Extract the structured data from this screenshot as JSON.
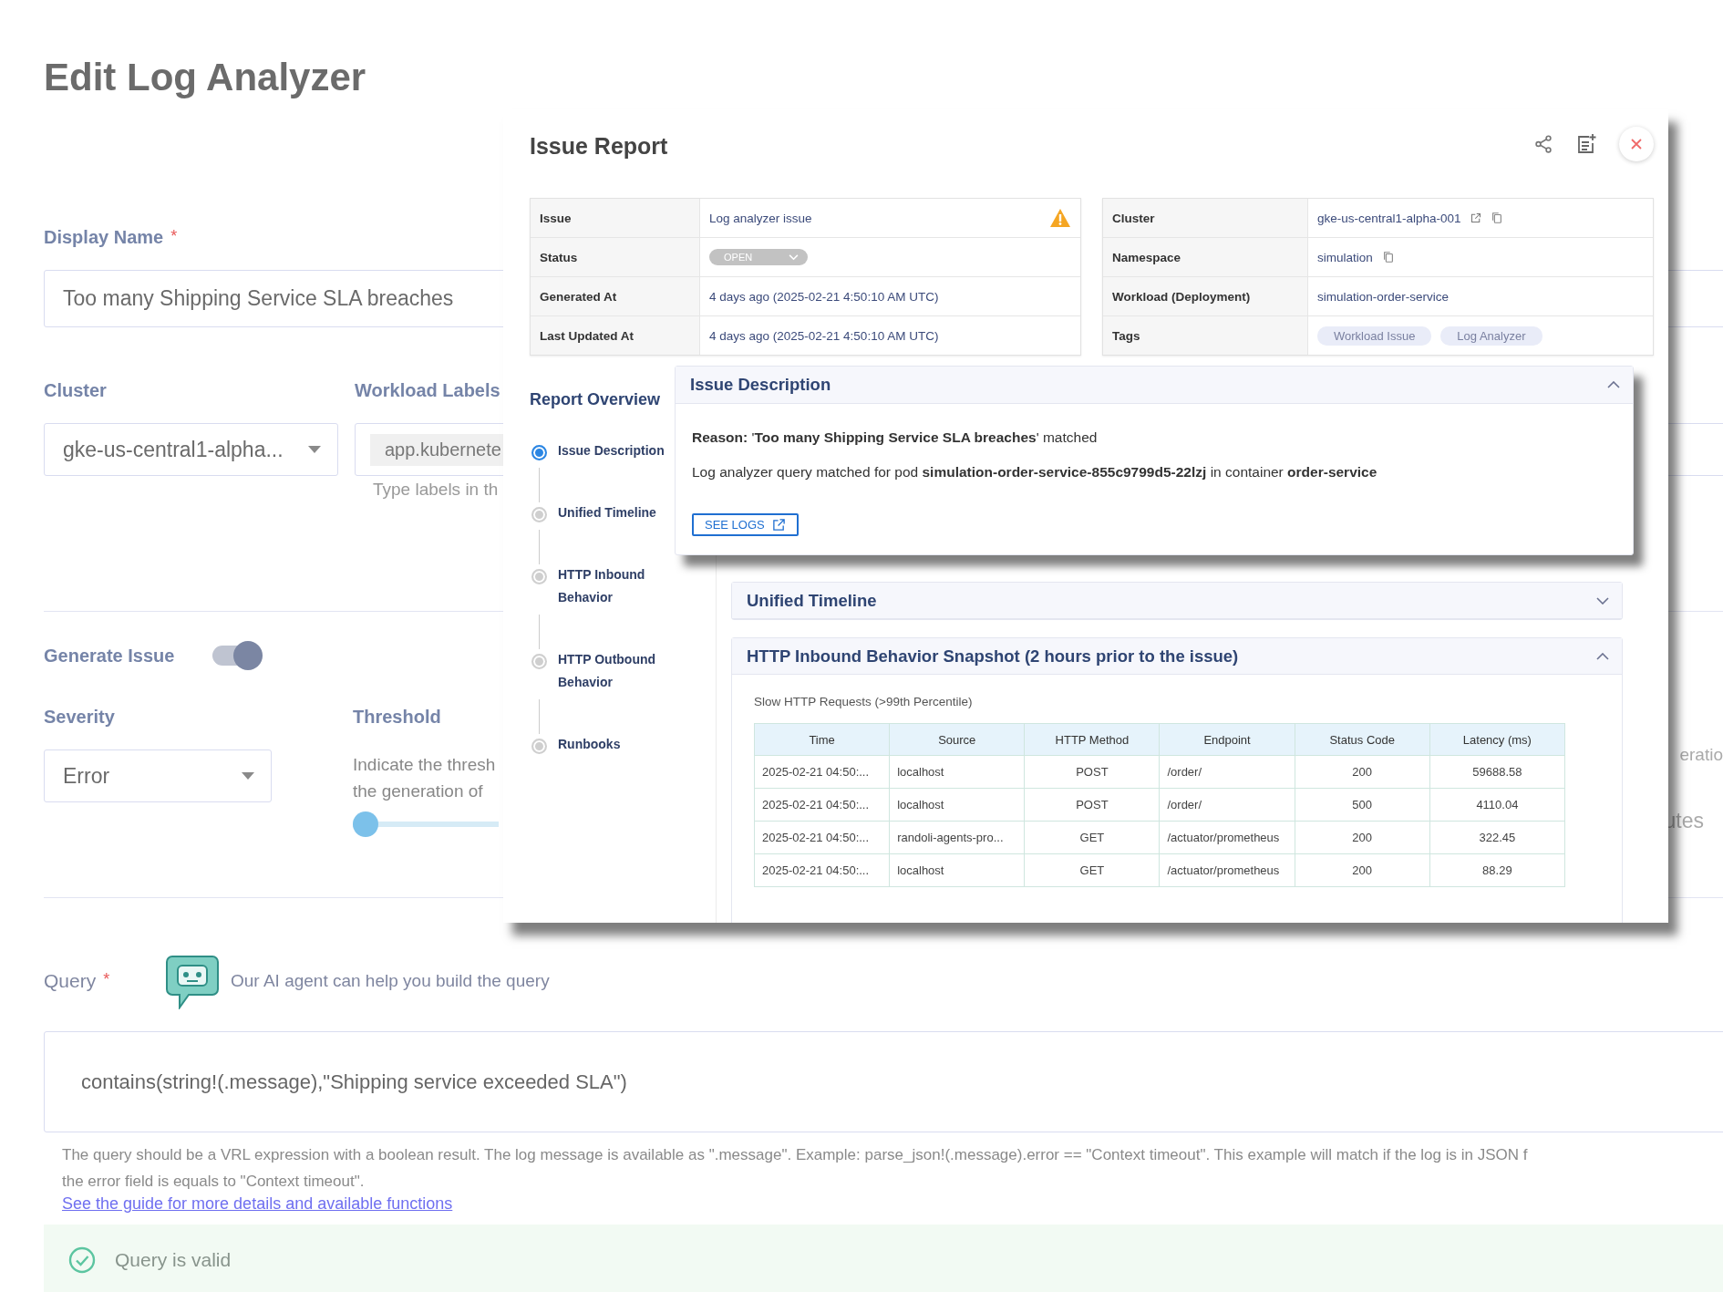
{
  "page": {
    "title": "Edit Log Analyzer"
  },
  "form": {
    "display_name": {
      "label": "Display Name",
      "required_mark": "*",
      "value": "Too many Shipping Service SLA breaches"
    },
    "cluster": {
      "label": "Cluster",
      "value": "gke-us-central1-alpha..."
    },
    "workload_labels": {
      "label": "Workload Labels",
      "chip": "app.kubernete",
      "hint": "Type labels in th"
    },
    "generate_issue": {
      "label": "Generate Issue",
      "on": true
    },
    "severity": {
      "label": "Severity",
      "value": "Error"
    },
    "threshold": {
      "label": "Threshold",
      "description": "Indicate the thresh\nthe generation of",
      "level": 0
    },
    "time_window": {
      "description": "eratio",
      "unit": "utes"
    },
    "query": {
      "label": "Query",
      "required_mark": "*",
      "ai_hint": "Our AI agent can help you build the query",
      "value": "contains(string!(.message),\"Shipping service exceeded SLA\")",
      "help": "The query should be a VRL expression with a boolean result. The log message is available as \".message\". Example: parse_json!(.message).error == \"Context timeout\". This example will match if the log is in JSON f\nthe error field is equals to \"Context timeout\".",
      "guide_link": "See the guide for more details and available functions",
      "validation": "Query is valid"
    }
  },
  "issue_report": {
    "title": "Issue Report",
    "left_details": [
      {
        "label": "Issue",
        "value": "Log analyzer issue",
        "kind": "warning"
      },
      {
        "label": "Status",
        "value": "OPEN",
        "kind": "status"
      },
      {
        "label": "Generated At",
        "value": "4 days ago (2025-02-21 4:50:10 AM UTC)",
        "kind": "text"
      },
      {
        "label": "Last Updated At",
        "value": "4 days ago (2025-02-21 4:50:10 AM UTC)",
        "kind": "text"
      }
    ],
    "right_details": [
      {
        "label": "Cluster",
        "value": "gke-us-central1-alpha-001",
        "kind": "link_copy"
      },
      {
        "label": "Namespace",
        "value": "simulation",
        "kind": "copy"
      },
      {
        "label": "Workload (Deployment)",
        "value": "simulation-order-service",
        "kind": "text"
      },
      {
        "label": "Tags",
        "tags": [
          "Workload Issue",
          "Log Analyzer"
        ],
        "kind": "tags"
      }
    ],
    "overview": {
      "title": "Report Overview",
      "items": [
        {
          "label": "Issue Description",
          "selected": true
        },
        {
          "label": "Unified Timeline",
          "selected": false
        },
        {
          "label": "HTTP Inbound Behavior",
          "selected": false
        },
        {
          "label": "HTTP Outbound Behavior",
          "selected": false
        },
        {
          "label": "Runbooks",
          "selected": false
        }
      ]
    },
    "sections": [
      {
        "kind": "description",
        "title": "Issue Description",
        "expanded": true,
        "reason": "**Reason:**  '**Too many Shipping Service SLA breaches**' matched",
        "detail": "Log analyzer query matched for pod **simulation-order-service-855c9799d5-22lzj** in container **order-service**",
        "button": "SEE LOGS"
      },
      {
        "kind": "plain",
        "title": "Unified Timeline",
        "expanded": false
      },
      {
        "kind": "table",
        "title": "HTTP Inbound Behavior Snapshot (2 hours prior to the issue)",
        "expanded": true,
        "subtitle": "Slow HTTP Requests (>99th Percentile)",
        "columns": [
          "Time",
          "Source",
          "HTTP Method",
          "Endpoint",
          "Status Code",
          "Latency (ms)"
        ],
        "rows": [
          [
            "2025-02-21 04:50:...",
            "localhost",
            "POST",
            "/order/",
            "200",
            "59688.58"
          ],
          [
            "2025-02-21 04:50:...",
            "localhost",
            "POST",
            "/order/",
            "500",
            "4110.04"
          ],
          [
            "2025-02-21 04:50:...",
            "randoli-agents-pro...",
            "GET",
            "/actuator/prometheus",
            "200",
            "322.45"
          ],
          [
            "2025-02-21 04:50:...",
            "localhost",
            "GET",
            "/actuator/prometheus",
            "200",
            "88.29"
          ]
        ]
      }
    ]
  }
}
